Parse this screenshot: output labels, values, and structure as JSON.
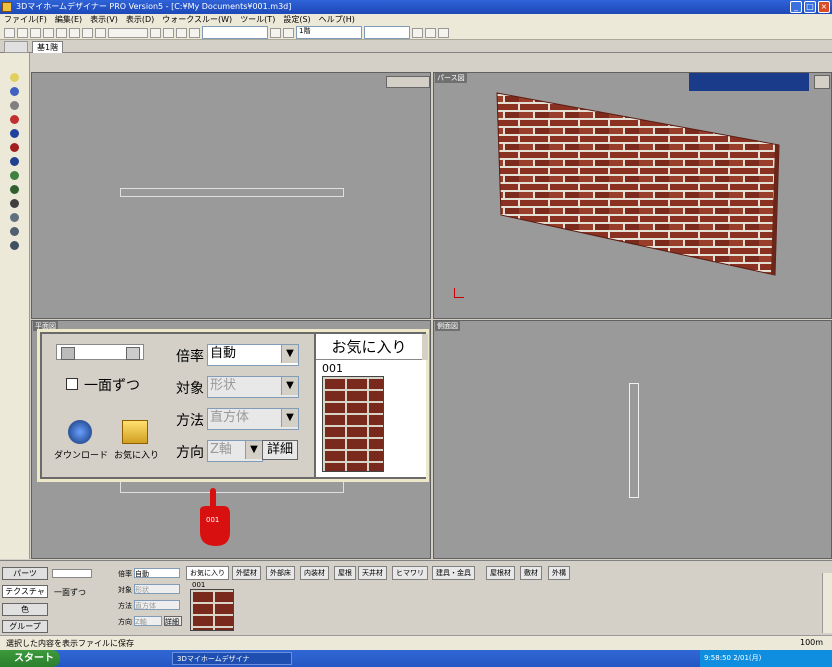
{
  "window": {
    "title": "3Dマイホームデザイナー PRO Version5 - [C:¥My Documents¥001.m3d]"
  },
  "menu": [
    "ファイル(F)",
    "編集(E)",
    "表示(V)",
    "表示(D)",
    "ウォークスルー(W)",
    "ツール(T)",
    "設定(S)",
    "ヘルプ(H)"
  ],
  "toolbar": {
    "layer_select": "1階",
    "color_select": "",
    "text_field": ""
  },
  "tabs": {
    "floor": "基1階"
  },
  "viewports": {
    "top_left": "",
    "top_right": "パース図",
    "bottom_left": "平面図",
    "bottom_right": "側面図"
  },
  "panel": {
    "one_by_one": "一面ずつ",
    "download": "ダウンロード",
    "favorites_btn": "お気に入り",
    "scale_label": "倍率",
    "scale_value": "自動",
    "target_label": "対象",
    "target_value": "形状",
    "method_label": "方法",
    "method_value": "直方体",
    "direction_label": "方向",
    "direction_value": "Z軸",
    "detail_button": "詳細",
    "favorites_title": "お気に入り",
    "item_number": "001",
    "cursor_badge": "001"
  },
  "bottom": {
    "parts_btn": "パーツ",
    "texture_btn": "テクスチャ",
    "color_btn": "色",
    "group_btn": "グループ",
    "one_by_one": "一面ずつ",
    "scale_label": "倍率",
    "scale_value": "自動",
    "target_label": "対象",
    "target_value": "形状",
    "method_label": "方法",
    "method_value": "直方体",
    "direction_label": "方向",
    "direction_value": "Z軸",
    "detail": "詳細",
    "tabs": [
      "お気に入り",
      "外壁材",
      "外部床",
      "内装材",
      "屋根",
      "天井材",
      "ヒマワリ",
      "建具・金具",
      "屋根材",
      "敷材",
      "外構"
    ],
    "item_number": "001"
  },
  "status": {
    "message": "選択した内容を表示ファイルに保存",
    "zoom": "100m"
  },
  "taskbar": {
    "start": "スタート",
    "task": "3Dマイホームデザイナ",
    "clock": "9:58:50 2/01(月)"
  }
}
